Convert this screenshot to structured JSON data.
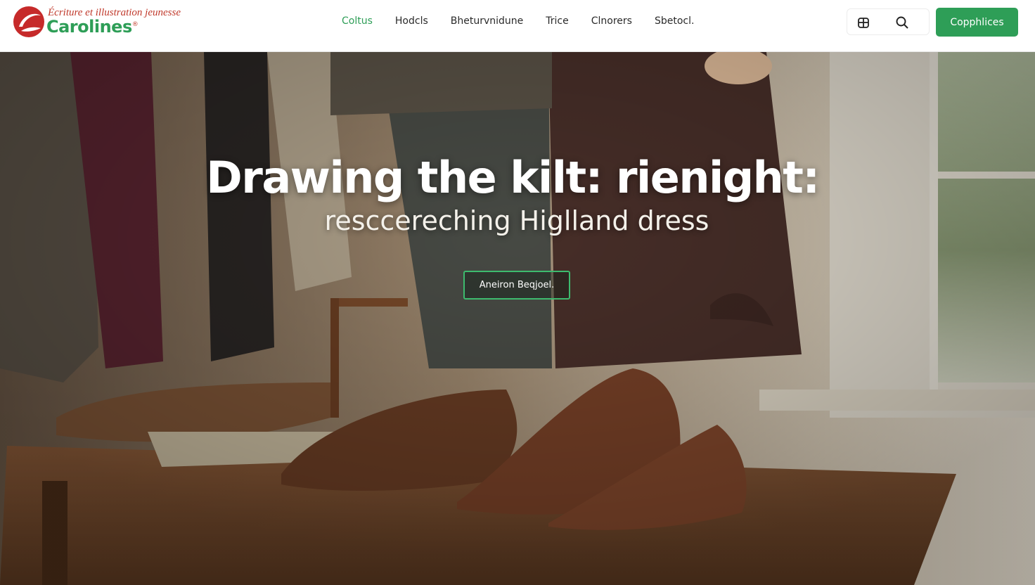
{
  "logo": {
    "tagline": "Écriture et illustration jeunesse",
    "brand": "Carolines",
    "reg": "®",
    "mark_color": "#c62a2a"
  },
  "nav": {
    "items": [
      "Coltus",
      "Hodcls",
      "Bheturvnidune",
      "Trice",
      "Clnorers",
      "Sbetocl."
    ],
    "active_index": 0
  },
  "header_icons": [
    "cart-icon",
    "search-icon"
  ],
  "cta": {
    "label": "Copphlices"
  },
  "hero": {
    "title": "Drawing the kilt: rienight:",
    "subtitle": "resccereching Higlland dress",
    "button_label": "Aneiron Beqjoel."
  },
  "colors": {
    "accent": "#2e9e57",
    "brand_red": "#c0392b",
    "button_border": "#3dbb6e"
  }
}
